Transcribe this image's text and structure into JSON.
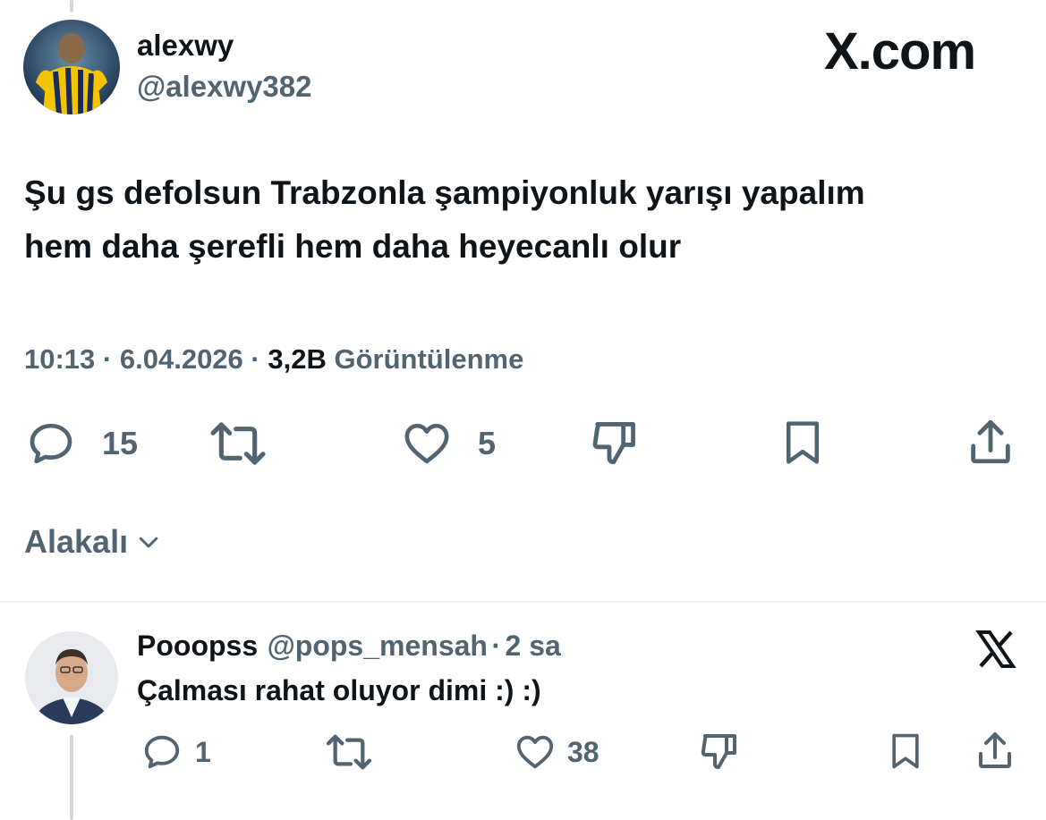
{
  "tweet": {
    "author_name": "alexwy",
    "author_handle": "@alexwy382",
    "site_logo": "X.com",
    "text_line1": "Şu gs defolsun Trabzonla şampiyonluk yarışı yapalım",
    "text_line2": "hem daha şerefli hem daha heyecanlı olur",
    "time": "10:13",
    "separator": "·",
    "date": "6.04.2026",
    "views_count": "3,2B",
    "views_label": "Görüntülenme",
    "actions": {
      "reply_count": "15",
      "retweet_count": "",
      "like_count": "5"
    }
  },
  "filter": {
    "label": "Alakalı"
  },
  "reply": {
    "author_name": "Pooopss",
    "author_handle": "@pops_mensah",
    "separator": "·",
    "age": "2 sa",
    "text": "Çalması rahat oluyor dimi :) :)",
    "actions": {
      "reply_count": "1",
      "like_count": "38"
    }
  },
  "icons": [
    "avatar",
    "x-logo-icon",
    "reply-icon",
    "retweet-icon",
    "heart-icon",
    "dislike-icon",
    "bookmark-icon",
    "share-icon",
    "chevron-down-icon"
  ],
  "colors": {
    "text": "#0f1419",
    "muted": "#536471",
    "divider": "#eff3f4",
    "thread": "#cfd9de"
  }
}
